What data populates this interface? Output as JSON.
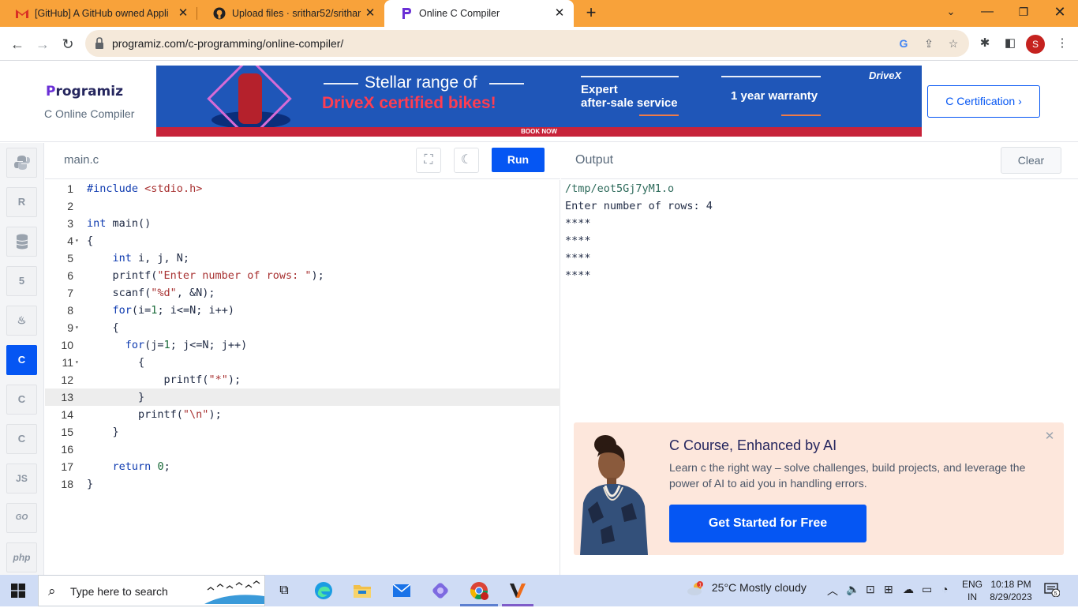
{
  "browser": {
    "tabs": [
      {
        "title": "[GitHub] A GitHub owned Applic",
        "icon": "gmail-icon"
      },
      {
        "title": "Upload files · srithar52/srithar",
        "icon": "github-icon"
      },
      {
        "title": "Online C Compiler",
        "icon": "programiz-icon"
      }
    ],
    "new_tab": "+",
    "url": "programiz.com/c-programming/online-compiler/",
    "profile_initial": "S"
  },
  "site": {
    "logo_text": "rogramiz",
    "logo_letter": "P",
    "subtitle": "C Online Compiler",
    "certification": "C Certification ›",
    "ad": {
      "headline": "Stellar range of",
      "subheadline": "DriveX certified bikes!",
      "feature1_line1": "Expert",
      "feature1_line2": "after-sale service",
      "feature2": "1 year warranty",
      "brand": "DriveX",
      "cta": "BOOK NOW"
    }
  },
  "languages": [
    {
      "name": "python",
      "label": "",
      "active": false
    },
    {
      "name": "r",
      "label": "R",
      "active": false
    },
    {
      "name": "sql",
      "label": "",
      "active": false
    },
    {
      "name": "html",
      "label": "5",
      "active": false
    },
    {
      "name": "java",
      "label": "",
      "active": false
    },
    {
      "name": "c",
      "label": "C",
      "active": true
    },
    {
      "name": "cpp",
      "label": "C",
      "active": false
    },
    {
      "name": "csharp",
      "label": "C",
      "active": false
    },
    {
      "name": "javascript",
      "label": "JS",
      "active": false
    },
    {
      "name": "go",
      "label": "GO",
      "active": false
    },
    {
      "name": "php",
      "label": "php",
      "active": false
    }
  ],
  "editor": {
    "filename": "main.c",
    "run_label": "Run",
    "lines": [
      "#include <stdio.h>",
      "",
      "int main()",
      "{",
      "    int i, j, N;",
      "    printf(\"Enter number of rows: \");",
      "    scanf(\"%d\", &N);",
      "    for(i=1; i<=N; i++)",
      "    {",
      "      for(j=1; j<=N; j++)",
      "        {",
      "            printf(\"*\");",
      "        }",
      "        printf(\"\\n\");",
      "    }",
      "",
      "    return 0;",
      "}"
    ],
    "highlighted_line": 13
  },
  "output": {
    "title": "Output",
    "clear_label": "Clear",
    "lines": [
      "/tmp/eot5Gj7yM1.o",
      "Enter number of rows: 4",
      "****",
      "****",
      "****",
      "****"
    ]
  },
  "promo": {
    "title": "C Course, Enhanced by AI",
    "text": "Learn c the right way – solve challenges, build projects, and leverage the power of AI to aid you in handling errors.",
    "button": "Get Started for Free"
  },
  "taskbar": {
    "search_placeholder": "Type here to search",
    "weather": "25°C  Mostly cloudy",
    "weather_badge": "1",
    "lang_line1": "ENG",
    "lang_line2": "IN",
    "time": "10:18 PM",
    "date": "8/29/2023",
    "notifications": "5"
  },
  "colors": {
    "accent": "#0556f3",
    "tabstrip": "#f8a23a",
    "promo_bg": "#fde7dc"
  }
}
